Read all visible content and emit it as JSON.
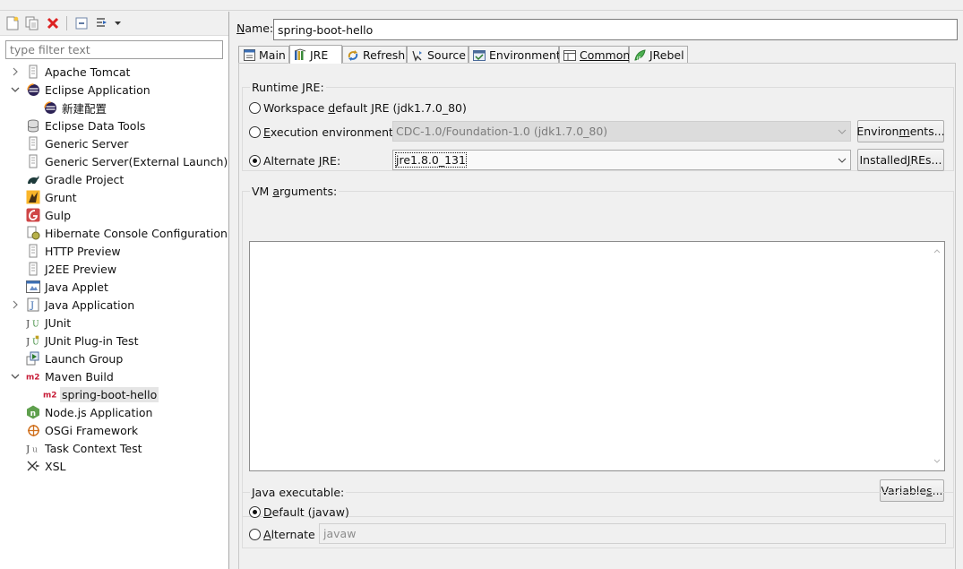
{
  "left_panel": {
    "toolbar": {
      "new_icon": "new-config-icon",
      "duplicate_icon": "duplicate-icon",
      "delete_icon": "delete-icon",
      "collapse_icon": "collapse-all-icon",
      "filter_icon": "filter-menu-icon"
    },
    "filter_placeholder": "type filter text",
    "tree": [
      {
        "label": "Apache Tomcat",
        "icon": "tomcat-icon",
        "level": 0,
        "toggle": "collapsed"
      },
      {
        "label": "Eclipse Application",
        "icon": "eclipse-icon",
        "level": 0,
        "toggle": "expanded"
      },
      {
        "label": "新建配置",
        "icon": "eclipse-icon",
        "level": 1
      },
      {
        "label": "Eclipse Data Tools",
        "icon": "database-icon",
        "level": 0
      },
      {
        "label": "Generic Server",
        "icon": "server-icon",
        "level": 0
      },
      {
        "label": "Generic Server(External Launch)",
        "icon": "server-icon",
        "level": 0
      },
      {
        "label": "Gradle Project",
        "icon": "gradle-icon",
        "level": 0
      },
      {
        "label": "Grunt",
        "icon": "grunt-icon",
        "level": 0
      },
      {
        "label": "Gulp",
        "icon": "gulp-icon",
        "level": 0
      },
      {
        "label": "Hibernate Console Configuration",
        "icon": "hibernate-icon",
        "level": 0
      },
      {
        "label": "HTTP Preview",
        "icon": "server-icon",
        "level": 0
      },
      {
        "label": "J2EE Preview",
        "icon": "server-icon",
        "level": 0
      },
      {
        "label": "Java Applet",
        "icon": "applet-icon",
        "level": 0
      },
      {
        "label": "Java Application",
        "icon": "java-app-icon",
        "level": 0,
        "toggle": "collapsed"
      },
      {
        "label": "JUnit",
        "icon": "junit-icon",
        "level": 0
      },
      {
        "label": "JUnit Plug-in Test",
        "icon": "junit-plugin-icon",
        "level": 0
      },
      {
        "label": "Launch Group",
        "icon": "launch-group-icon",
        "level": 0
      },
      {
        "label": "Maven Build",
        "icon": "maven-icon",
        "level": 0,
        "toggle": "expanded"
      },
      {
        "label": "spring-boot-hello",
        "icon": "maven-icon",
        "level": 1,
        "selected": true
      },
      {
        "label": "Node.js Application",
        "icon": "nodejs-icon",
        "level": 0
      },
      {
        "label": "OSGi Framework",
        "icon": "osgi-icon",
        "level": 0
      },
      {
        "label": "Task Context Test",
        "icon": "task-context-icon",
        "level": 0
      },
      {
        "label": "XSL",
        "icon": "xsl-icon",
        "level": 0
      }
    ]
  },
  "right_panel": {
    "name_label": "Name:",
    "name_mnemonic": "N",
    "name_rest": "ame:",
    "name_value": "spring-boot-hello",
    "tabs": [
      {
        "label": "Main",
        "icon": "main-tab-icon"
      },
      {
        "label": "JRE",
        "icon": "jre-tab-icon",
        "active": true
      },
      {
        "label": "Refresh",
        "icon": "refresh-tab-icon"
      },
      {
        "label": "Source",
        "icon": "source-tab-icon"
      },
      {
        "label": "Environment",
        "icon": "environment-tab-icon"
      },
      {
        "label": "Common",
        "icon": "common-tab-icon"
      },
      {
        "label": "JRebel",
        "icon": "jrebel-tab-icon"
      }
    ],
    "runtime_jre": {
      "title": "Runtime JRE:",
      "workspace_pre": "Workspace ",
      "workspace_mn": "d",
      "workspace_post": "efault JRE (jdk1.7.0_80)",
      "exec_mn": "E",
      "exec_post": "xecution environment:",
      "exec_value": "CDC-1.0/Foundation-1.0 (jdk1.7.0_80)",
      "environments_pre": "Environ",
      "environments_mn": "m",
      "environments_post": "ents...",
      "alt_pre": "Alternate ",
      "alt_mn": "J",
      "alt_post": "RE:",
      "alt_value": "jre1.8.0_131",
      "installed_pre": "Installed ",
      "installed_mn": "J",
      "installed_post": "REs...",
      "selected": "alternate"
    },
    "vm_arguments": {
      "title_pre": "VM ",
      "title_mn": "a",
      "title_post": "rguments:",
      "value": "",
      "variables_pre": "Variable",
      "variables_mn": "s",
      "variables_post": "..."
    },
    "java_executable": {
      "title": "Java executable:",
      "default_mn": "D",
      "default_post": "efault (javaw)",
      "alternate_mn": "A",
      "alternate_post": "lternate",
      "alternate_value": "javaw",
      "selected": "default"
    }
  }
}
